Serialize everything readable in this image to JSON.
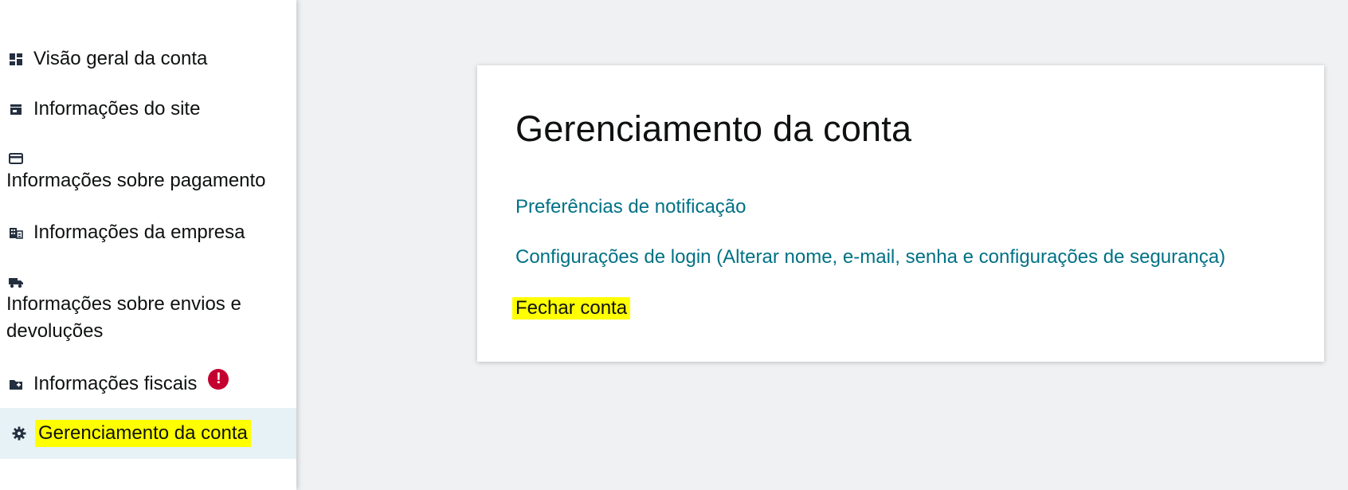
{
  "sidebar": {
    "items": [
      {
        "label": "Visão geral da conta",
        "icon": "dashboard-icon"
      },
      {
        "label": "Informações do site",
        "icon": "storefront-icon"
      },
      {
        "label": "Informações sobre pagamento",
        "icon": "credit-card-icon"
      },
      {
        "label": "Informações da empresa",
        "icon": "building-icon"
      },
      {
        "label_line1": "Informações sobre envios e",
        "label_line2": "devoluções",
        "icon": "truck-icon"
      },
      {
        "label": "Informações fiscais",
        "icon": "folder-add-icon",
        "badge": "!"
      },
      {
        "label": "Gerenciamento da conta",
        "icon": "gear-icon"
      }
    ],
    "active_index": 6
  },
  "main": {
    "title": "Gerenciamento da conta",
    "links": [
      {
        "label": "Preferências de notificação"
      },
      {
        "label": "Configurações de login (Alterar nome, e-mail, senha e configurações de segurança)"
      },
      {
        "label": "Fechar conta"
      }
    ]
  },
  "colors": {
    "link": "#007185",
    "highlight": "#ffff00",
    "alert": "#c40030",
    "active_bg": "#e6f2f5",
    "page_bg": "#eff1f3"
  }
}
